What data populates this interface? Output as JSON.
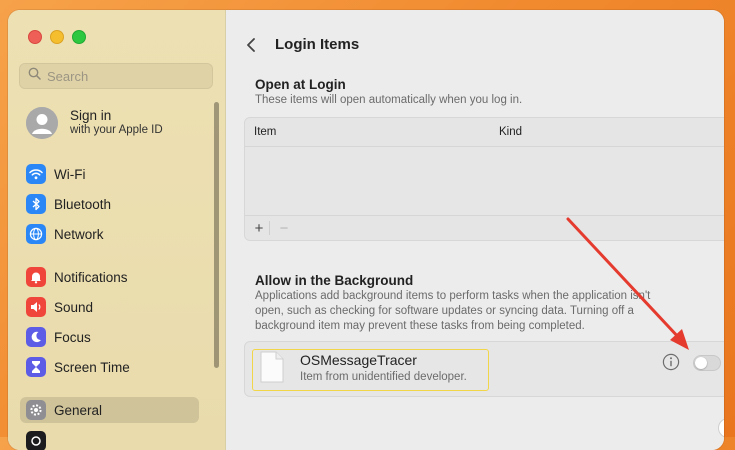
{
  "sidebar": {
    "search_placeholder": "Search",
    "account": {
      "title": "Sign in",
      "subtitle": "with your Apple ID"
    },
    "items": [
      {
        "label": "Wi-Fi",
        "icon": "wifi-icon",
        "color": "#2b87f6"
      },
      {
        "label": "Bluetooth",
        "icon": "bluetooth-icon",
        "color": "#2b87f6"
      },
      {
        "label": "Network",
        "icon": "globe-icon",
        "color": "#2b87f6"
      },
      {
        "label": "Notifications",
        "icon": "bell-icon",
        "color": "#f0453a"
      },
      {
        "label": "Sound",
        "icon": "speaker-icon",
        "color": "#f0453a"
      },
      {
        "label": "Focus",
        "icon": "moon-icon",
        "color": "#5d5ce6"
      },
      {
        "label": "Screen Time",
        "icon": "hourglass-icon",
        "color": "#5d5ce6"
      },
      {
        "label": "General",
        "icon": "gear-icon",
        "color": "#8e8e93",
        "selected": true
      }
    ]
  },
  "main": {
    "title": "Login Items",
    "open_at_login": {
      "title": "Open at Login",
      "description": "These items will open automatically when you log in.",
      "columns": [
        "Item",
        "Kind"
      ],
      "add_label": "+",
      "remove_label": "−"
    },
    "background": {
      "title": "Allow in the Background",
      "description_lines": [
        "Applications add background items to perform tasks when the application isn't",
        "open, such as checking for software updates or syncing data. Turning off a",
        "background item may prevent these tasks from being completed."
      ],
      "item": {
        "name": "OSMessageTracer",
        "subtitle": "Item from unidentified developer.",
        "enabled": false
      }
    },
    "help_label": "?"
  },
  "annotation": {
    "arrow_color": "#e53b2f",
    "highlight_color": "#f2d64a"
  }
}
